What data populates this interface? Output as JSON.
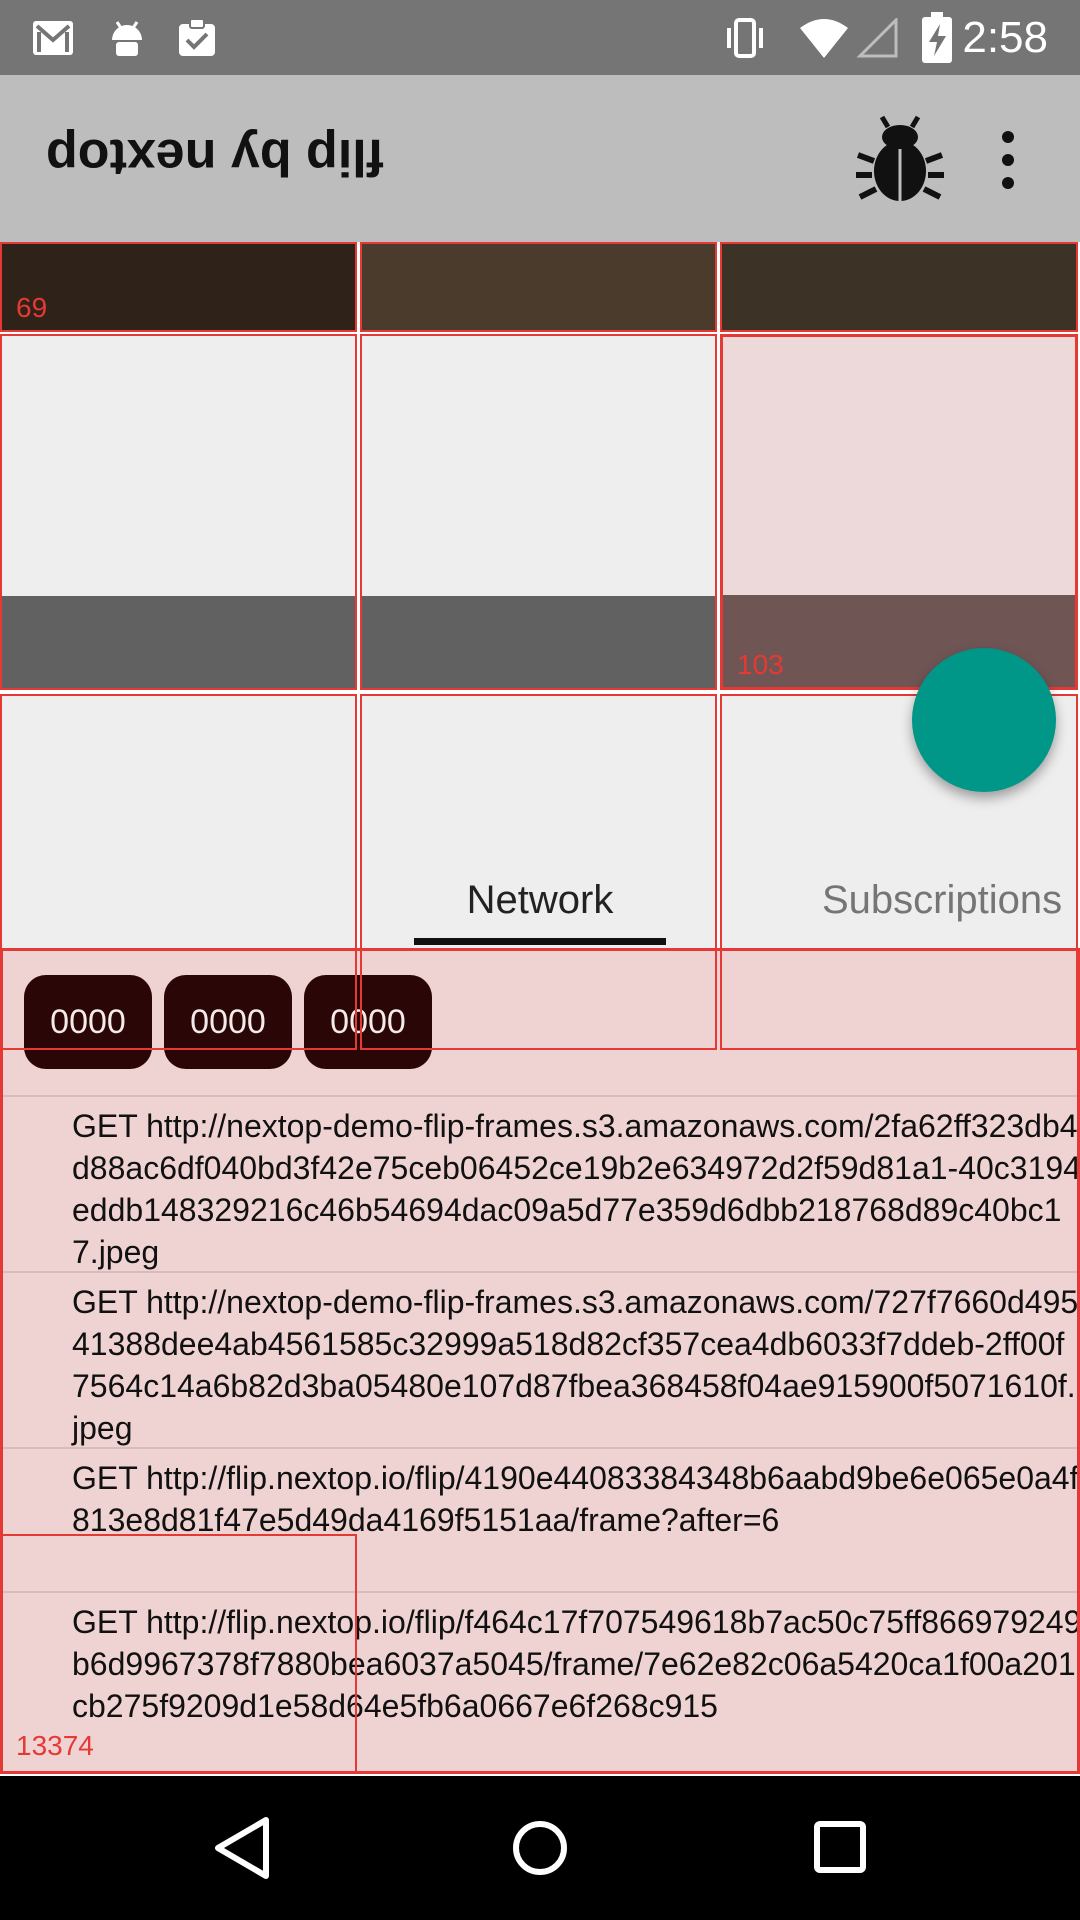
{
  "status_bar": {
    "time": "2:58",
    "left_icons": [
      "gmail-icon",
      "android-icon",
      "clipboard-check-icon"
    ],
    "right_icons": [
      "vibrate-icon",
      "wifi-icon",
      "signal-icon",
      "battery-charging-icon"
    ]
  },
  "app_bar": {
    "title": "flip by nextop",
    "actions": [
      "bug-icon",
      "overflow-menu-icon"
    ]
  },
  "grid": {
    "cell_labels": [
      "69",
      "103",
      "13374"
    ]
  },
  "tabs": {
    "items": [
      "Network",
      "Subscriptions"
    ],
    "selected": "Network"
  },
  "network": {
    "chips": [
      "0000",
      "0000",
      "0000"
    ],
    "requests": [
      "GET http://nextop-demo-flip-frames.s3.amazonaws.com/2fa62ff323db4d88ac6df040bd3f42e75ceb06452ce19b2e634972d2f59d81a1-40c3194eddb148329216c46b54694dac09a5d77e359d6dbb218768d89c40bc17.jpeg",
      "GET http://nextop-demo-flip-frames.s3.amazonaws.com/727f7660d49541388dee4ab4561585c32999a518d82cf357cea4db6033f7ddeb-2ff00f7564c14a6b82d3ba05480e107d87fbea368458f04ae915900f5071610f.jpeg",
      "GET http://flip.nextop.io/flip/4190e44083384348b6aabd9be6e065e0a4f813e8d81f47e5d49da4169f5151aa/frame?after=6",
      "GET http://flip.nextop.io/flip/f464c17f707549618b7ac50c75ff866979249b6d9967378f7880bea6037a5045/frame/7e62e82c06a5420ca1f00a201cb275f9209d1e58d64e5fb6a0667e6f268c915"
    ]
  },
  "colors": {
    "accent": "#009688",
    "outline": "#e53935",
    "chip": "#2b0606"
  }
}
